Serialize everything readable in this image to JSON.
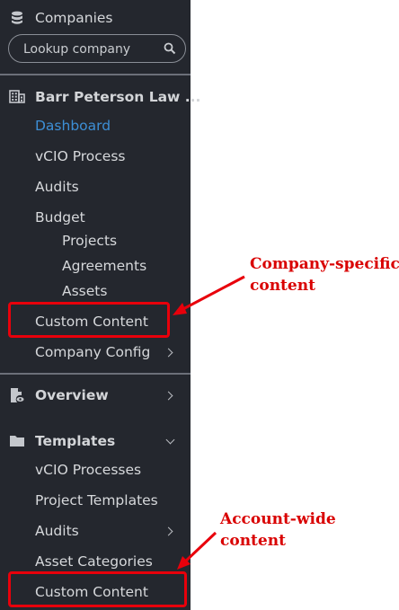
{
  "sidebar": {
    "companies_header": "Companies",
    "search": {
      "placeholder": "Lookup company"
    },
    "company_name": "Barr Peterson Law ...",
    "company_items": [
      {
        "label": "Dashboard",
        "active": true
      },
      {
        "label": "vCIO Process"
      },
      {
        "label": "Audits"
      },
      {
        "label": "Budget"
      },
      {
        "label": "Projects"
      },
      {
        "label": "Agreements"
      },
      {
        "label": "Assets"
      },
      {
        "label": "Custom Content"
      },
      {
        "label": "Company Config",
        "has_submenu": true
      }
    ],
    "overview": "Overview",
    "templates": {
      "label": "Templates",
      "expanded": true,
      "items": [
        {
          "label": "vCIO Processes"
        },
        {
          "label": "Project Templates"
        },
        {
          "label": "Audits",
          "has_submenu": true
        },
        {
          "label": "Asset Categories"
        },
        {
          "label": "Custom Content"
        }
      ]
    }
  },
  "annotations": [
    {
      "lines": [
        "Company-specific",
        "content"
      ]
    },
    {
      "lines": [
        "Account-wide",
        "content"
      ]
    }
  ],
  "colors": {
    "sidebar_bg": "#24272e",
    "text": "#d6d8db",
    "active": "#3d8fd6",
    "annotation": "#d90000"
  }
}
